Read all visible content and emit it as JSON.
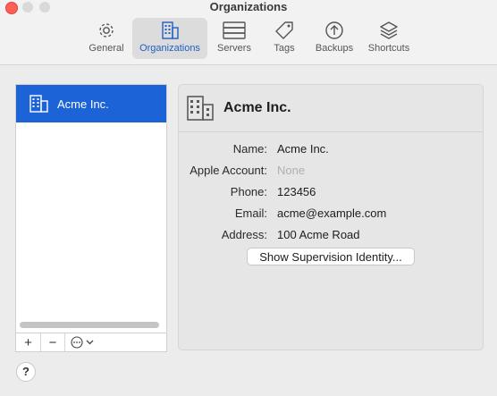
{
  "window": {
    "title": "Organizations"
  },
  "toolbar": {
    "items": [
      {
        "label": "General",
        "icon": "gear-icon",
        "active": false
      },
      {
        "label": "Organizations",
        "icon": "building-icon",
        "active": true
      },
      {
        "label": "Servers",
        "icon": "server-icon",
        "active": false
      },
      {
        "label": "Tags",
        "icon": "tag-icon",
        "active": false
      },
      {
        "label": "Backups",
        "icon": "arrow-up-circle-icon",
        "active": false
      },
      {
        "label": "Shortcuts",
        "icon": "layers-icon",
        "active": false
      }
    ]
  },
  "sidebar": {
    "organizations": [
      {
        "name": "Acme Inc.",
        "selected": true
      }
    ],
    "add_label": "+",
    "remove_label": "−"
  },
  "detail": {
    "title": "Acme Inc.",
    "fields": [
      {
        "label": "Name:",
        "value": "Acme Inc."
      },
      {
        "label": "Apple Account:",
        "value": "None"
      },
      {
        "label": "Phone:",
        "value": "123456"
      },
      {
        "label": "Email:",
        "value": "acme@example.com"
      },
      {
        "label": "Address:",
        "value": "100 Acme Road"
      }
    ],
    "supervision_button": "Show Supervision Identity..."
  },
  "help": {
    "label": "?"
  },
  "colors": {
    "accent": "#1c63d8",
    "close": "#fe5f57"
  }
}
